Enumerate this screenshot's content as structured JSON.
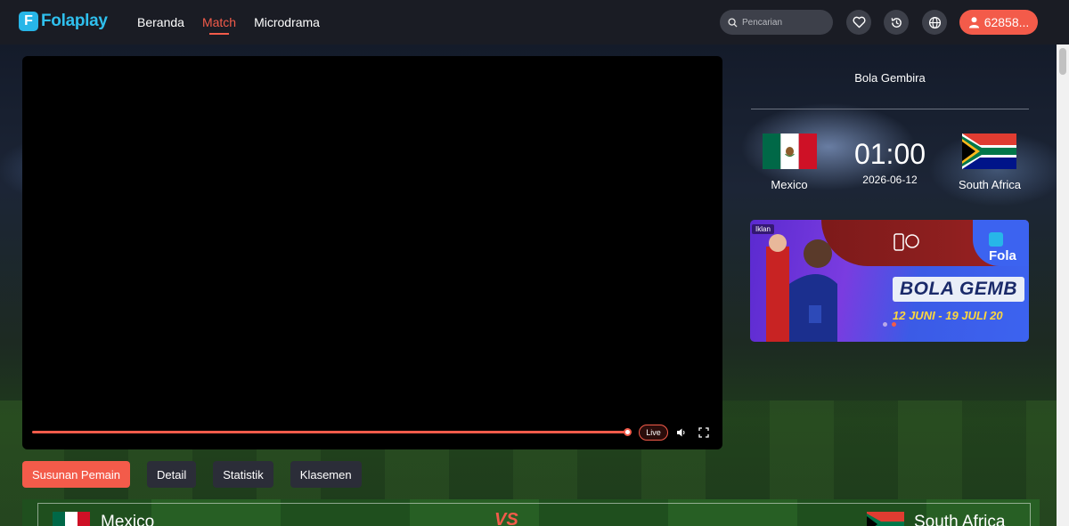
{
  "header": {
    "logo_text": "Folaplay",
    "logo_letter": "F",
    "nav": [
      {
        "label": "Beranda"
      },
      {
        "label": "Match"
      },
      {
        "label": "Microdrama"
      }
    ],
    "search_placeholder": "Pencarian",
    "user_label": "62858..."
  },
  "player": {
    "progress_fraction": 0.97,
    "live_label": "Live"
  },
  "match": {
    "league": "Bola Gembira",
    "home_team": "Mexico",
    "away_team": "South Africa",
    "time": "01:00",
    "date": "2026-06-12"
  },
  "ad": {
    "tag": "Iklan",
    "brand": "Fola",
    "title": "BOLA GEMB",
    "dates": "12 JUNI - 19 JULI 20"
  },
  "tabs": [
    {
      "label": "Susunan Pemain"
    },
    {
      "label": "Detail"
    },
    {
      "label": "Statistik"
    },
    {
      "label": "Klasemen"
    }
  ],
  "lineup": {
    "home": "Mexico",
    "away": "South Africa",
    "vs": "VS"
  },
  "colors": {
    "accent": "#f35b4a",
    "header_bg": "#1a1c24",
    "logo_blue": "#27b6e8"
  }
}
